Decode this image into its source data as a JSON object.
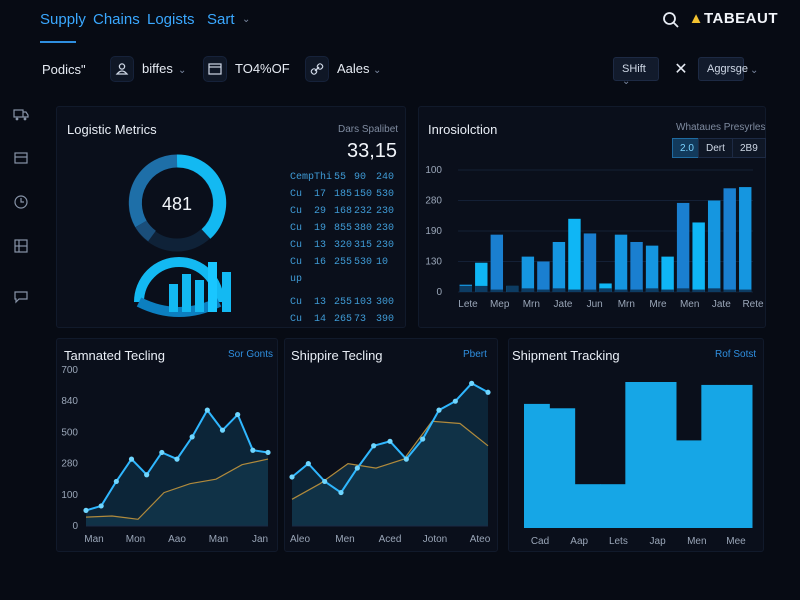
{
  "nav": {
    "tabs": [
      "Supply",
      "Chains",
      "Logists",
      "Sart"
    ],
    "brand": "TABEAUT"
  },
  "toolbar": {
    "title": "Podics\"",
    "filter1_label": "biffes",
    "filter2_label": "TO4%OF",
    "filter3_label": "Aales",
    "shift_pill": "SHift",
    "aggregate_pill": "Aggrsge"
  },
  "sidebar": {
    "icons": [
      "truck-icon",
      "box-icon",
      "clock-icon",
      "warehouse-icon",
      "chat-icon"
    ]
  },
  "logistic_metrics": {
    "title": "Logistic Metrics",
    "corner_label": "Dars Spalibet",
    "big_value": "33,15",
    "gauge_value": "481",
    "table_rows": [
      [
        "Cemp",
        "Thi",
        "55",
        "90",
        "240"
      ],
      [
        "Cu",
        "17",
        "185",
        "150",
        "530"
      ],
      [
        "Cu",
        "29",
        "168",
        "232",
        "230"
      ],
      [
        "Cu",
        "19",
        "855",
        "380",
        "230"
      ],
      [
        "Cu",
        "13",
        "320",
        "315",
        "230"
      ],
      [
        "Cu",
        "16",
        "255",
        "530",
        "10"
      ],
      [
        "up",
        "",
        "",
        "",
        ""
      ],
      [
        "Cu",
        "13",
        "255",
        "103",
        "300"
      ],
      [
        "Cu",
        "14",
        "265",
        "73",
        "390"
      ]
    ]
  },
  "chart_data": [
    {
      "type": "bar",
      "title": "Inrosiolction",
      "subtitle": "Whataues Presyrles",
      "segments": [
        "2.0",
        "Dert",
        "2B9"
      ],
      "active_segment": "2.0",
      "y_ticks": [
        "100",
        "280",
        "190",
        "130",
        "0"
      ],
      "x_tick_labels": [
        "Lete",
        "Mep",
        "Mrn",
        "Jate",
        "Jun",
        "Mrn",
        "Mre",
        "Men",
        "Jate",
        "Rete"
      ],
      "series": [
        {
          "values": [
            6,
            24,
            47,
            5,
            29,
            25,
            41,
            60,
            48,
            7,
            47,
            41,
            38,
            29,
            73,
            57,
            75,
            85,
            86
          ]
        }
      ],
      "series_b": [
        {
          "values": [
            5,
            5,
            2,
            5,
            3,
            2,
            3,
            2,
            2,
            3,
            2,
            2,
            3,
            2,
            3,
            2,
            3,
            2,
            2
          ]
        }
      ]
    },
    {
      "type": "area",
      "title": "Tamnated Tecling",
      "link": "Sor Gonts",
      "y_ticks": [
        "700",
        "840",
        "500",
        "280",
        "100",
        "0"
      ],
      "x_tick_labels": [
        "Man",
        "Mon",
        "Aao",
        "Man",
        "Jan"
      ],
      "ylim": [
        0,
        700
      ],
      "series": [
        {
          "values": [
            70,
            90,
            200,
            300,
            230,
            330,
            300,
            400,
            520,
            430,
            500,
            340,
            330
          ]
        },
        {
          "values": [
            40,
            45,
            30,
            150,
            190,
            210,
            275,
            300
          ]
        }
      ]
    },
    {
      "type": "area",
      "title": "Shippire Tecling",
      "link": "Pbert",
      "y_ticks": [],
      "x_tick_labels": [
        "Aleo",
        "Men",
        "Aced",
        "Joton",
        "Ateo"
      ],
      "ylim": [
        0,
        700
      ],
      "series": [
        {
          "values": [
            220,
            280,
            200,
            150,
            260,
            360,
            380,
            300,
            390,
            520,
            560,
            640,
            600
          ]
        },
        {
          "values": [
            120,
            190,
            280,
            260,
            300,
            470,
            460,
            360
          ]
        }
      ]
    },
    {
      "type": "bar",
      "title": "Shipment Tracking",
      "link": "Rof Sotst",
      "x_tick_labels": [
        "Cad",
        "Aap",
        "Lets",
        "Jap",
        "Men",
        "Mee"
      ],
      "ylim": [
        0,
        100
      ],
      "series": [
        {
          "values": [
            85,
            82,
            30,
            30,
            100,
            100,
            60,
            98,
            98
          ]
        }
      ]
    }
  ]
}
